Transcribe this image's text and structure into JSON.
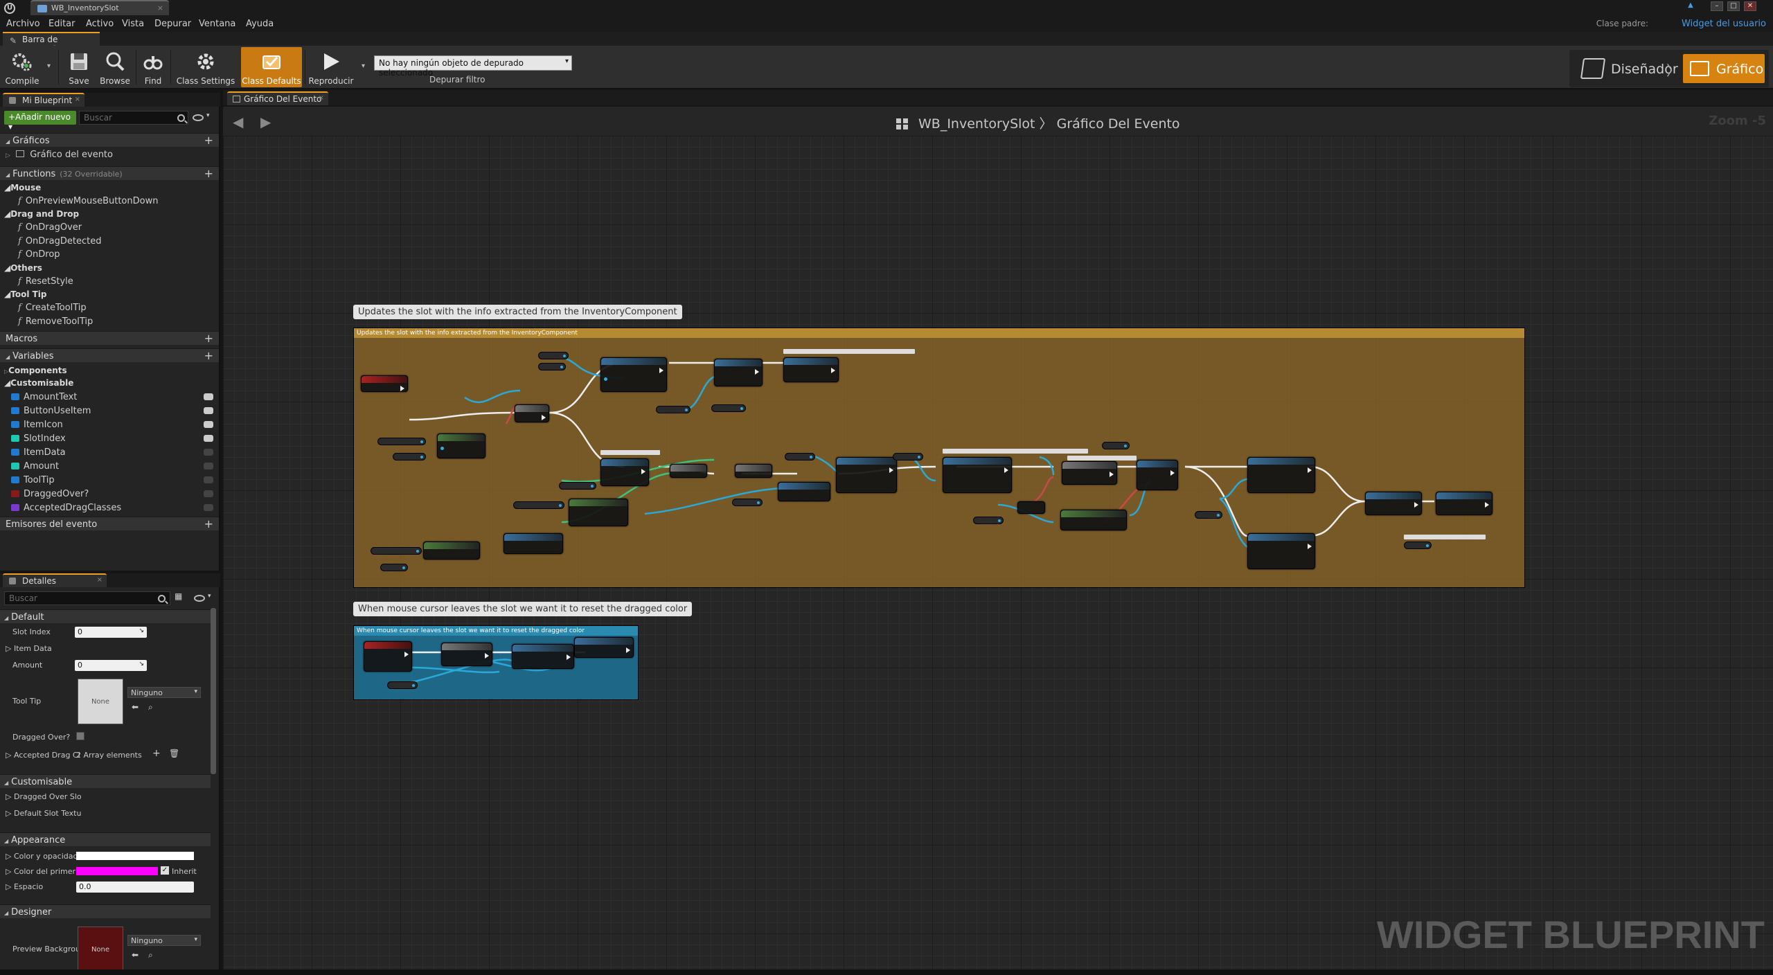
{
  "window": {
    "tab_title": "WB_InventorySlot",
    "close_glyph": "×",
    "logo": "U",
    "controls": [
      "▲",
      "–",
      "□",
      "✕"
    ]
  },
  "menu": {
    "items": [
      "Archivo",
      "Editar",
      "Activo",
      "Vista",
      "Depurar",
      "Ventana",
      "Ayuda"
    ],
    "parent_class_label": "Clase padre:",
    "parent_class_value": "Widget del usuario"
  },
  "toolbar": {
    "tab_label": "Barra de Herramier",
    "buttons": {
      "compile": "Compile",
      "save": "Save",
      "browse": "Browse",
      "find": "Find",
      "class_settings": "Class Settings",
      "class_defaults": "Class Defaults",
      "play": "Reproducir"
    },
    "debug_select": "No hay ningún objeto de depurado seleccionado",
    "debug_filter": "Depurar filtro",
    "mode_designer": "Diseñador",
    "mode_graph": "Gráfico",
    "mode_chevron": "〉"
  },
  "my_blueprint": {
    "tab_label": "Mi Blueprint",
    "add_new": "+Añadir nuevo ▾",
    "search_placeholder": "Buscar",
    "graphs_header": "Gráficos",
    "event_graph_item": "Gráfico del evento",
    "functions_header": "Functions",
    "functions_note": "(32 Overridable)",
    "groups": {
      "mouse": "Mouse",
      "drag_drop": "Drag and Drop",
      "others": "Others",
      "tooltip": "Tool Tip"
    },
    "functions": {
      "on_preview_mouse": "OnPreviewMouseButtonDown",
      "on_drag_over": "OnDragOver",
      "on_drag_detected": "OnDragDetected",
      "on_drop": "OnDrop",
      "reset_style": "ResetStyle",
      "create_tooltip": "CreateToolTip",
      "remove_tooltip": "RemoveToolTip"
    },
    "macros_header": "Macros",
    "variables_header": "Variables",
    "var_groups": {
      "components": "Components",
      "customisable": "Customisable"
    },
    "variables": [
      {
        "name": "AmountText",
        "color": "#1f7ad0",
        "visible": true
      },
      {
        "name": "ButtonUseItem",
        "color": "#1f7ad0",
        "visible": true
      },
      {
        "name": "ItemIcon",
        "color": "#1f7ad0",
        "visible": true
      },
      {
        "name": "SlotIndex",
        "color": "#1fc8b0",
        "visible": true
      },
      {
        "name": "ItemData",
        "color": "#1f7ad0",
        "visible": false
      },
      {
        "name": "Amount",
        "color": "#1fc8b0",
        "visible": false
      },
      {
        "name": "ToolTip",
        "color": "#1f7ad0",
        "visible": false
      },
      {
        "name": "DraggedOver?",
        "color": "#8a1a1a",
        "visible": false
      },
      {
        "name": "AcceptedDragClasses",
        "color": "#7a3ad0",
        "visible": false
      }
    ],
    "dispatchers_header": "Emisores del evento"
  },
  "details": {
    "tab_label": "Detalles",
    "search_placeholder": "Buscar",
    "default_header": "Default",
    "slot_index_label": "Slot Index",
    "slot_index_value": "0",
    "item_data_label": "Item Data",
    "amount_label": "Amount",
    "amount_value": "0",
    "tooltip_label": "Tool Tip",
    "tooltip_thumb": "None",
    "tooltip_select": "Ninguno",
    "dragged_over_label": "Dragged Over?",
    "accepted_label": "Accepted Drag Cl",
    "accepted_value": "2 Array elements",
    "customisable_header": "Customisable",
    "dragged_over_slot_label": "Dragged Over Slo",
    "default_slot_text_label": "Default Slot Textu",
    "appearance_header": "Appearance",
    "color_opacity_label": "Color y opacidad",
    "foreground_label": "Color del primer p",
    "inherit_label": "Inherit",
    "spacing_label": "Espacio",
    "spacing_value": "0.0",
    "designer_header": "Designer",
    "preview_bg_label": "Preview Backgrou",
    "preview_thumb": "None",
    "preview_select": "Ninguno",
    "colors": {
      "color_opacity": "#ffffff",
      "foreground": "#ff00ff"
    }
  },
  "graph": {
    "tab_label": "Gráfico Del Evento",
    "breadcrumb_bp": "WB_InventorySlot",
    "breadcrumb_sep": "〉",
    "breadcrumb_graph": "Gráfico Del Evento",
    "zoom": "Zoom -5",
    "watermark": "WIDGET BLUEPRINT",
    "comment1_bubble": "Updates the slot with the info extracted from the InventoryComponent",
    "comment1_header": "Updates the slot with the info extracted from the InventoryComponent",
    "comment2_bubble": "When mouse cursor leaves the slot we want it to reset the dragged color",
    "comment2_header": "When mouse cursor leaves the slot we want it to reset the dragged color",
    "colors": {
      "comment1": "#9a7028",
      "comment2": "#2b8ab0",
      "accent": "#d78312"
    }
  }
}
